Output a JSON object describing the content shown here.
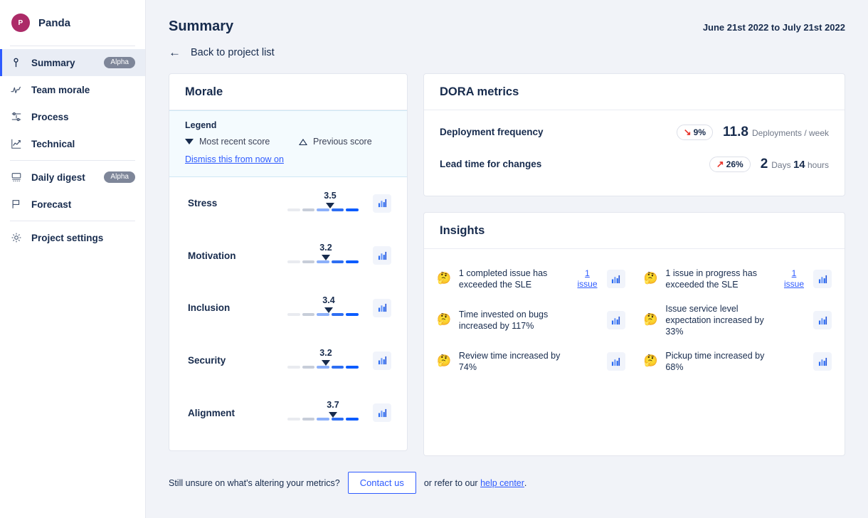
{
  "sidebar": {
    "brand": {
      "initial": "P",
      "name": "Panda"
    },
    "groups": [
      {
        "items": [
          {
            "label": "Summary",
            "icon": "pin-icon",
            "badge": "Alpha",
            "active": true
          },
          {
            "label": "Team morale",
            "icon": "pulse-icon",
            "badge": "",
            "active": false
          },
          {
            "label": "Process",
            "icon": "process-icon",
            "badge": "",
            "active": false
          },
          {
            "label": "Technical",
            "icon": "trend-chart-icon",
            "badge": "",
            "active": false
          }
        ]
      },
      {
        "items": [
          {
            "label": "Daily digest",
            "icon": "digest-icon",
            "badge": "Alpha",
            "active": false
          },
          {
            "label": "Forecast",
            "icon": "flag-icon",
            "badge": "",
            "active": false
          }
        ]
      },
      {
        "items": [
          {
            "label": "Project settings",
            "icon": "gear-icon",
            "badge": "",
            "active": false
          }
        ]
      }
    ]
  },
  "header": {
    "title": "Summary",
    "date_range": "June 21st 2022 to July 21st 2022",
    "back_label": "Back to project list",
    "back_icon": "arrow-left-icon"
  },
  "morale": {
    "title": "Morale",
    "legend": {
      "title": "Legend",
      "recent_label": "Most recent score",
      "previous_label": "Previous score",
      "dismiss_label": "Dismiss this from now on"
    },
    "rows": [
      {
        "label": "Stress",
        "value": "3.5",
        "score": 3.5
      },
      {
        "label": "Motivation",
        "value": "3.2",
        "score": 3.2
      },
      {
        "label": "Inclusion",
        "value": "3.4",
        "score": 3.4
      },
      {
        "label": "Security",
        "value": "3.2",
        "score": 3.2
      },
      {
        "label": "Alignment",
        "value": "3.7",
        "score": 3.7
      }
    ],
    "segment_colors": [
      "#e9ebf0",
      "#c7cdd9",
      "#8cb0fa",
      "#2e6ef2",
      "#0b5cff"
    ]
  },
  "dora": {
    "title": "DORA metrics",
    "rows": [
      {
        "name": "Deployment frequency",
        "delta": "9%",
        "delta_direction": "down",
        "value": "11.8",
        "unit_prefix": "",
        "unit": "Deployments / week",
        "unit_bold": "",
        "unit_suffix": ""
      },
      {
        "name": "Lead time for changes",
        "delta": "26%",
        "delta_direction": "up",
        "value": "2",
        "unit_prefix": "Days",
        "unit": "",
        "unit_bold": "14",
        "unit_suffix": "hours"
      }
    ],
    "delta_color": "#e8332a"
  },
  "insights": {
    "title": "Insights",
    "emoji": "🤔",
    "items": [
      {
        "text": "1 completed issue has exceeded the SLE",
        "link": "1 issue"
      },
      {
        "text": "1 issue in progress has exceeded the SLE",
        "link": "1 issue"
      },
      {
        "text": "Time invested on bugs increased by 117%",
        "link": ""
      },
      {
        "text": "Issue service level expectation increased by 33%",
        "link": ""
      },
      {
        "text": "Review time increased by 74%",
        "link": ""
      },
      {
        "text": "Pickup time increased by 68%",
        "link": ""
      }
    ]
  },
  "footer": {
    "text_before": "Still unsure on what's altering your metrics?",
    "button_label": "Contact us",
    "text_middle": "or refer to our",
    "link_label": "help center",
    "text_after": "."
  }
}
